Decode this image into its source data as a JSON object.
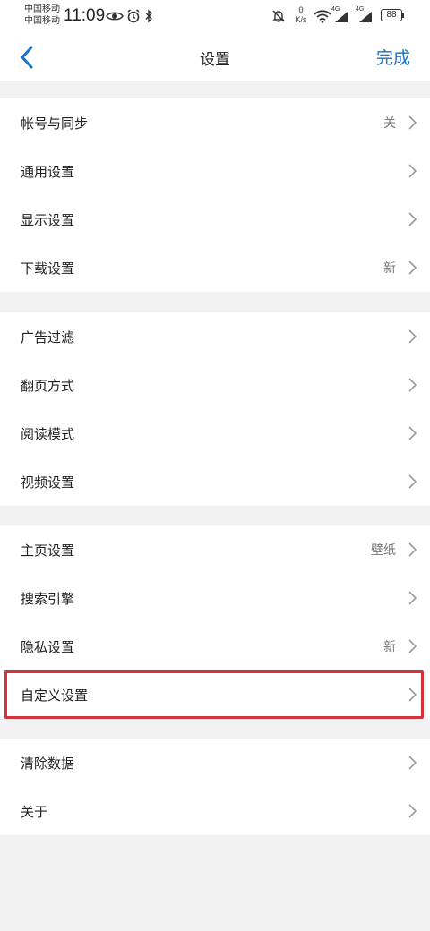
{
  "status_bar": {
    "carrier_1": "中国移动",
    "carrier_2": "中国移动",
    "time": "11:09",
    "net_speed_value": "0",
    "net_speed_unit": "K/s",
    "signal_1_label": "4G",
    "signal_2_label": "4G",
    "battery": "88",
    "icons": [
      "eye-icon",
      "alarm-icon",
      "bluetooth-icon",
      "mute-icon",
      "wifi-icon",
      "signal-icon",
      "battery-icon"
    ]
  },
  "nav": {
    "title": "设置",
    "done_label": "完成",
    "back_icon": "chevron-left-icon"
  },
  "colors": {
    "accent": "#1a73c9",
    "highlight": "#d1343d",
    "background": "#f2f2f2"
  },
  "groups": [
    {
      "rows": [
        {
          "label": "帐号与同步",
          "value": "关"
        },
        {
          "label": "通用设置",
          "value": ""
        },
        {
          "label": "显示设置",
          "value": ""
        },
        {
          "label": "下载设置",
          "value": "新"
        }
      ]
    },
    {
      "rows": [
        {
          "label": "广告过滤",
          "value": ""
        },
        {
          "label": "翻页方式",
          "value": ""
        },
        {
          "label": "阅读模式",
          "value": ""
        },
        {
          "label": "视频设置",
          "value": ""
        }
      ]
    },
    {
      "rows": [
        {
          "label": "主页设置",
          "value": "壁纸"
        },
        {
          "label": "搜索引擎",
          "value": ""
        },
        {
          "label": "隐私设置",
          "value": "新"
        },
        {
          "label": "自定义设置",
          "value": ""
        }
      ]
    },
    {
      "rows": [
        {
          "label": "清除数据",
          "value": ""
        },
        {
          "label": "关于",
          "value": ""
        }
      ]
    }
  ]
}
